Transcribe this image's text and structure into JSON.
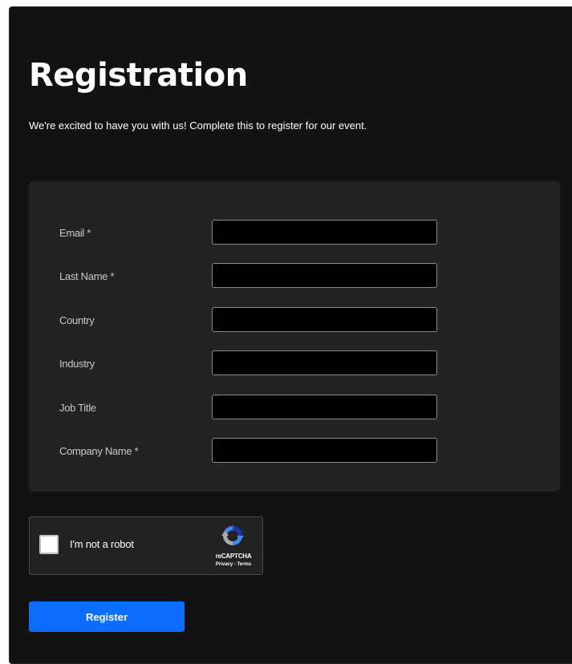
{
  "page": {
    "title": "Registration",
    "subtitle": "We're excited to have you with us! Complete this to register for our event."
  },
  "form": {
    "fields": [
      {
        "label": "Email *",
        "value": "",
        "placeholder": ""
      },
      {
        "label": "Last Name *",
        "value": "",
        "placeholder": ""
      },
      {
        "label": "Country",
        "value": "",
        "placeholder": ""
      },
      {
        "label": "Industry",
        "value": "",
        "placeholder": ""
      },
      {
        "label": "Job Title",
        "value": "",
        "placeholder": ""
      },
      {
        "label": "Company Name *",
        "value": "",
        "placeholder": ""
      }
    ]
  },
  "captcha": {
    "label": "I'm not a robot",
    "brand": "reCAPTCHA",
    "privacy": "Privacy",
    "separator": "-",
    "terms": "Terms",
    "icon": "recaptcha-logo-icon",
    "checked": false
  },
  "actions": {
    "register_label": "Register"
  },
  "colors": {
    "panel_bg": "#121212",
    "form_card_bg": "#232323",
    "accent": "#0d6efd",
    "input_bg": "#000000"
  }
}
